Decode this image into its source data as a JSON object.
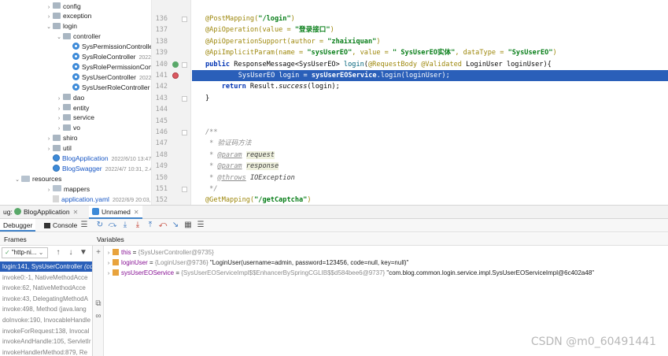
{
  "project_tree": {
    "items": [
      {
        "label": "config",
        "kind": "package",
        "arrow": "›",
        "indent": 1
      },
      {
        "label": "exception",
        "kind": "package",
        "arrow": "›",
        "indent": 1
      },
      {
        "label": "login",
        "kind": "package",
        "arrow": "⌄",
        "indent": 1
      },
      {
        "label": "controller",
        "kind": "package",
        "arrow": "⌄",
        "indent": 2
      },
      {
        "label": "SysPermissionController",
        "kind": "class",
        "arrow": "",
        "indent": 3,
        "meta": ""
      },
      {
        "label": "SysRoleController",
        "kind": "class",
        "arrow": "",
        "indent": 3,
        "meta": "2022"
      },
      {
        "label": "SysRolePermissionController",
        "kind": "class",
        "arrow": "",
        "indent": 3,
        "meta": ""
      },
      {
        "label": "SysUserController",
        "kind": "class",
        "arrow": "",
        "indent": 3,
        "meta": "2022"
      },
      {
        "label": "SysUserRoleController",
        "kind": "class",
        "arrow": "",
        "indent": 3,
        "meta": ""
      },
      {
        "label": "dao",
        "kind": "package",
        "arrow": "›",
        "indent": 2
      },
      {
        "label": "entity",
        "kind": "package",
        "arrow": "›",
        "indent": 2
      },
      {
        "label": "service",
        "kind": "package",
        "arrow": "›",
        "indent": 2
      },
      {
        "label": "vo",
        "kind": "package",
        "arrow": "›",
        "indent": 2
      },
      {
        "label": "shiro",
        "kind": "package",
        "arrow": "›",
        "indent": 1
      },
      {
        "label": "util",
        "kind": "package",
        "arrow": "›",
        "indent": 1
      },
      {
        "label": "BlogApplication",
        "kind": "app",
        "arrow": "",
        "indent": 1,
        "meta": "2022/6/10 13:47, 7"
      },
      {
        "label": "BlogSwagger",
        "kind": "app",
        "arrow": "",
        "indent": 1,
        "meta": "2022/4/7 10:31, 2.47 K"
      },
      {
        "label": "resources",
        "kind": "folder",
        "arrow": "⌄",
        "indent": 0
      },
      {
        "label": "mappers",
        "kind": "folder",
        "arrow": "›",
        "indent": 1
      },
      {
        "label": "application.yaml",
        "kind": "yaml",
        "arrow": "",
        "indent": 1,
        "meta": "2022/6/9 20:03, 1.05 K"
      }
    ]
  },
  "editor": {
    "lines": [
      {
        "n": "136",
        "html": "<span class=\"ann\">@PostMapping(</span><span class=\"str\">\"/login\"</span><span class=\"ann\">)</span>"
      },
      {
        "n": "137",
        "html": "<span class=\"ann\">@ApiOperation(</span><span class=\"ann\">value = </span><span class=\"str\">\"登录接口\"</span><span class=\"ann\">)</span>"
      },
      {
        "n": "138",
        "html": "<span class=\"ann\">@ApiOperationSupport(</span><span class=\"ann\">author = </span><span class=\"str\">\"zhaixiquan\"</span><span class=\"ann\">)</span>"
      },
      {
        "n": "139",
        "html": "<span class=\"ann\">@ApiImplicitParam(</span><span class=\"ann\">name = </span><span class=\"str\">\"sysUserEO\"</span><span class=\"ann\">, value = </span><span class=\"str\">\" SysUserEO实体\"</span><span class=\"ann\">, dataType = </span><span class=\"str\">\"SysUserEO\"</span><span class=\"ann\">)</span>"
      },
      {
        "n": "140",
        "html": "<span class=\"kw\">public</span> ResponseMessage&lt;SysUserEO&gt; <span class=\"method\">login</span>(<span class=\"ann\">@RequestBody @Validated</span> LoginUser loginUser){"
      },
      {
        "n": "141",
        "html": "    SysUserEO login = <b>sysUserEOService</b>.login(loginUser);",
        "highlight": true
      },
      {
        "n": "142",
        "html": "    <span class=\"kw\">return</span> Result.<span class=\"italic\">success</span>(login);"
      },
      {
        "n": "143",
        "html": "}"
      },
      {
        "n": "144",
        "html": ""
      },
      {
        "n": "145",
        "html": ""
      },
      {
        "n": "146",
        "html": "<span class=\"cmt\">/**</span>"
      },
      {
        "n": "147",
        "html": "<span class=\"cmt\"> * 验证码方法</span>"
      },
      {
        "n": "148",
        "html": "<span class=\"cmt\"> * </span><span class=\"doctag\">@param</span> <span class=\"docparam\">request</span>"
      },
      {
        "n": "149",
        "html": "<span class=\"cmt\"> * </span><span class=\"doctag\">@param</span> <span class=\"docparam\">response</span>"
      },
      {
        "n": "150",
        "html": "<span class=\"cmt\"> * </span><span class=\"doctag\">@throws</span> <span class=\"cmt\" style=\"color:#3d3d3d\">IOException</span>"
      },
      {
        "n": "151",
        "html": "<span class=\"cmt\"> */</span>"
      },
      {
        "n": "152",
        "html": "<span class=\"ann\">@GetMapping(</span><span class=\"str\">\"/getCaptcha\"</span><span class=\"ann\">)</span>"
      }
    ]
  },
  "debug": {
    "prefix": "ug:",
    "tab1": "BlogApplication",
    "tab2": "Unnamed",
    "debugger_tab": "Debugger",
    "console_tab": "Console",
    "frames_label": "Frames",
    "variables_label": "Variables",
    "thread_name": "\"http-ni...",
    "frames": [
      {
        "method": "login:141, SysUserController",
        "pkg": " (com.blog.common.login.controller)",
        "selected": true
      },
      {
        "method": "invoke0:-1, NativeMethodAcce",
        "pkg": "",
        "selected": false
      },
      {
        "method": "invoke:62, NativeMethodAcce",
        "pkg": "",
        "selected": false
      },
      {
        "method": "invoke:43, DelegatingMethodA",
        "pkg": "",
        "selected": false
      },
      {
        "method": "invoke:498, Method (java.lang",
        "pkg": "",
        "selected": false
      },
      {
        "method": "doInvoke:190, InvocableHandle",
        "pkg": "",
        "selected": false
      },
      {
        "method": "invokeForRequest:138, Invocal",
        "pkg": "",
        "selected": false
      },
      {
        "method": "invokeAndHandle:105, ServletIr",
        "pkg": "",
        "selected": false
      },
      {
        "method": "invokeHandlerMethod:879, Re",
        "pkg": "",
        "selected": false
      }
    ],
    "variables": [
      {
        "expand": "›",
        "name": "this",
        "eq": " = ",
        "type": "{SysUserController@9735}",
        "value": "",
        "icon_color": "#e8a33d"
      },
      {
        "expand": "›",
        "name": "loginUser",
        "eq": " = ",
        "type": "{LoginUser@9736}",
        "value": " \"LoginUser(username=admin, password=123456, code=null, key=null)\"",
        "icon_color": "#e8a33d"
      },
      {
        "expand": "›",
        "name": "sysUserEOService",
        "eq": " = ",
        "type": "{SysUserEOServiceImpl$$EnhancerBySpringCGLIB$$d584bee6@9737}",
        "value": " \"com.blog.common.login.service.impl.SysUserEOServiceImpl@6c402a48\"",
        "icon_color": "#e8a33d"
      }
    ]
  },
  "watermark": "CSDN @m0_60491441"
}
